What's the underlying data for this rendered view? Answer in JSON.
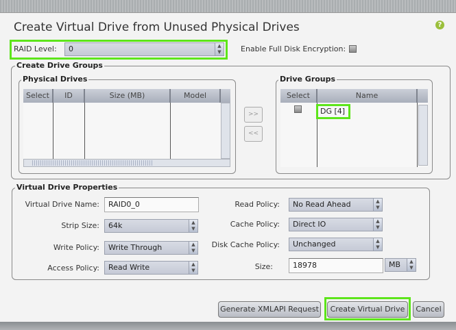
{
  "dialog": {
    "title": "Create Virtual Drive from Unused Physical Drives",
    "help_icon": "?"
  },
  "raid": {
    "label": "RAID Level:",
    "value": "0"
  },
  "encryption": {
    "label": "Enable Full Disk Encryption:",
    "checked": false
  },
  "create_drive_groups": {
    "legend": "Create Drive Groups",
    "physical_drives": {
      "legend": "Physical Drives",
      "columns": [
        "Select",
        "ID",
        "Size (MB)",
        "Model"
      ],
      "rows": []
    },
    "add_button": ">>",
    "remove_button": "<<",
    "drive_groups": {
      "legend": "Drive Groups",
      "columns": [
        "Select",
        "Name"
      ],
      "rows": [
        {
          "selected": false,
          "name": "DG [4]"
        }
      ]
    }
  },
  "properties": {
    "legend": "Virtual Drive Properties",
    "vd_name": {
      "label": "Virtual Drive Name:",
      "value": "RAID0_0"
    },
    "strip_size": {
      "label": "Strip Size:",
      "value": "64k"
    },
    "write_policy": {
      "label": "Write Policy:",
      "value": "Write Through"
    },
    "access_policy": {
      "label": "Access Policy:",
      "value": "Read Write"
    },
    "read_policy": {
      "label": "Read Policy:",
      "value": "No Read Ahead"
    },
    "cache_policy": {
      "label": "Cache Policy:",
      "value": "Direct IO"
    },
    "disk_cache_policy": {
      "label": "Disk Cache Policy:",
      "value": "Unchanged"
    },
    "size": {
      "label": "Size:",
      "value": "18978",
      "unit": "MB"
    }
  },
  "buttons": {
    "generate": "Generate XMLAPI Request",
    "create": "Create Virtual Drive",
    "cancel": "Cancel"
  },
  "colors": {
    "highlight": "#5de51a"
  }
}
